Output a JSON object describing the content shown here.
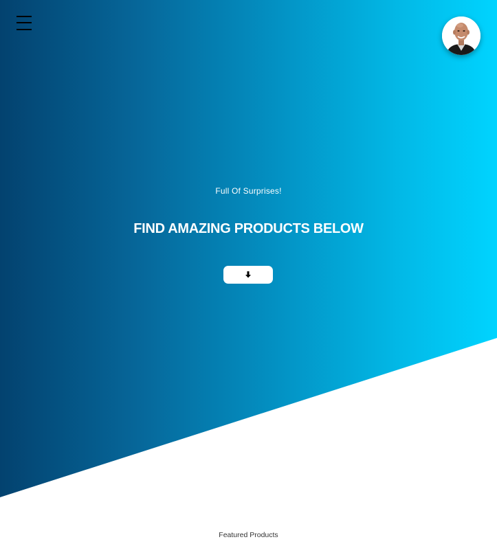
{
  "header": {
    "menu_icon": "hamburger-menu-icon",
    "avatar_icon": "user-avatar-photo"
  },
  "hero": {
    "kicker": "Full Of Surprises!",
    "title": "FIND AMAZING PRODUCTS BELOW",
    "scroll_button_icon": "arrow-down-icon",
    "gradient_start": "#03426f",
    "gradient_end": "#00d4ff"
  },
  "featured": {
    "heading": "Featured Products"
  }
}
